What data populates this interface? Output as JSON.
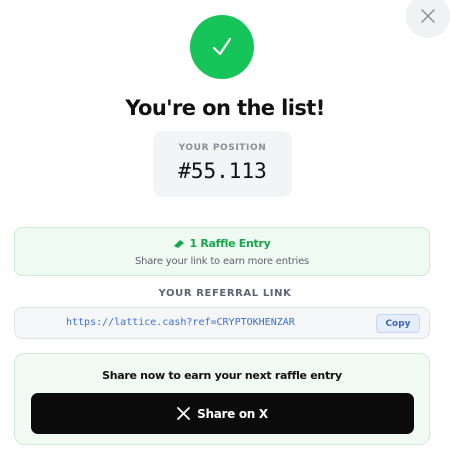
{
  "headline": "You're on the list!",
  "position": {
    "label": "YOUR POSITION",
    "value": "#55.113"
  },
  "raffle": {
    "title": "1 Raffle Entry",
    "subtitle": "Share your link to earn more entries",
    "icon": "ticket-icon"
  },
  "referral": {
    "label": "YOUR REFERRAL LINK",
    "url": "https://lattice.cash?ref=CRYPTOKHENZAR",
    "copy_label": "Copy"
  },
  "share": {
    "title": "Share now to earn your next raffle entry",
    "button_label": "Share on X",
    "icon": "x-logo-icon"
  },
  "colors": {
    "success": "#16c45a",
    "raffle_text": "#18a64c",
    "link": "#3b6fd8",
    "button_bg": "#0b0b0b"
  },
  "icons": {
    "close": "close-icon",
    "check": "check-icon"
  }
}
